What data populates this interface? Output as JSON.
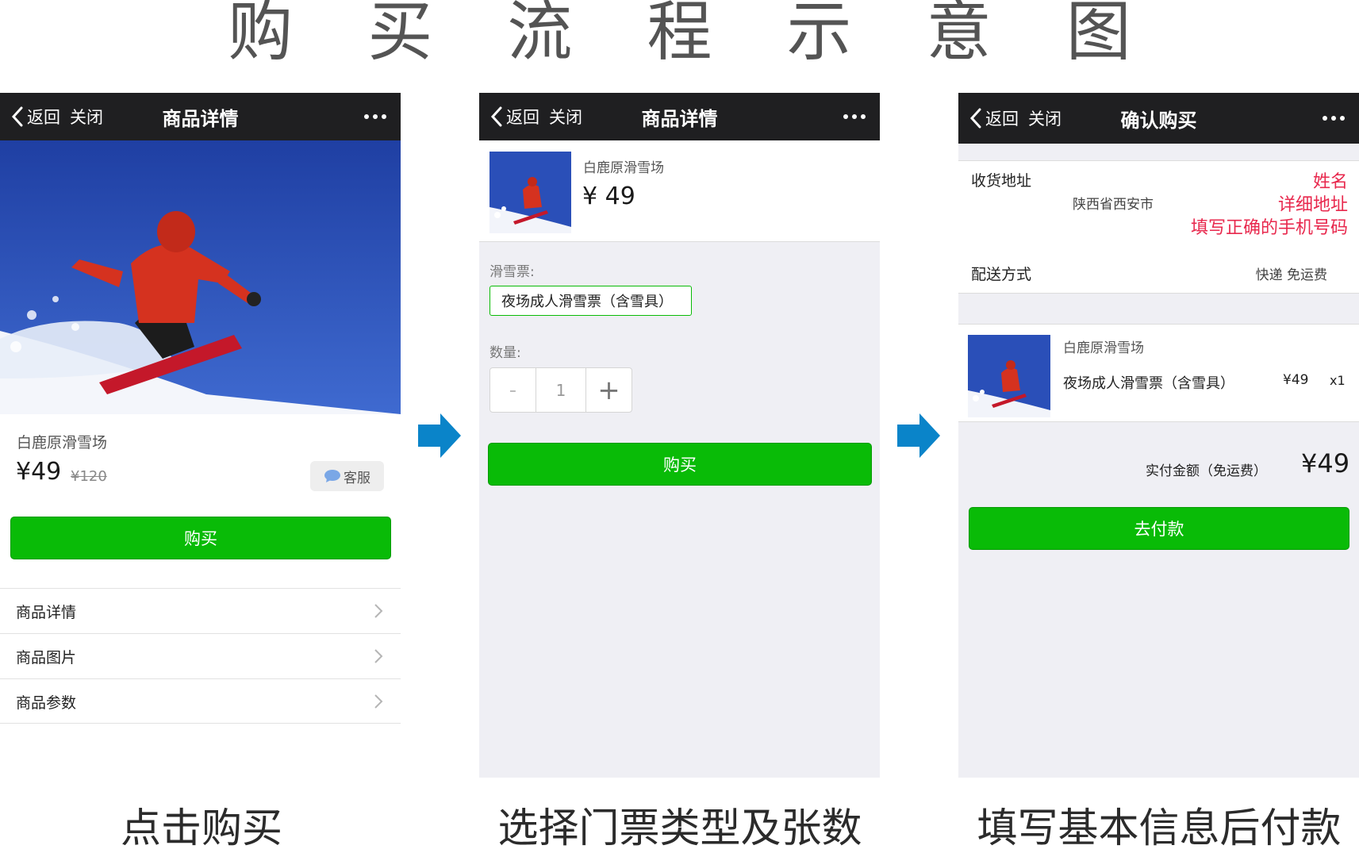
{
  "title": "购 买 流 程 示 意 图",
  "colors": {
    "accent_green": "#09bb07",
    "navbar": "#1f1f21",
    "arrow_blue": "#0a84c9",
    "highlight_red": "#e8284d"
  },
  "nav": {
    "back_icon": "chevron-left-icon",
    "back_label": "返回",
    "close_label": "关闭",
    "more_icon": "more-dots-icon"
  },
  "screen1": {
    "nav_title": "商品详情",
    "shop_name": "白鹿原滑雪场",
    "price": "¥49",
    "original_price": "¥120",
    "customer_service": "客服",
    "buy_button": "购买",
    "menu": [
      "商品详情",
      "商品图片",
      "商品参数"
    ],
    "caption": "点击购买"
  },
  "screen2": {
    "nav_title": "商品详情",
    "shop_name": "白鹿原滑雪场",
    "price": "¥ 49",
    "ticket_label": "滑雪票:",
    "ticket_option": "夜场成人滑雪票（含雪具）",
    "quantity_label": "数量:",
    "quantity_minus": "-",
    "quantity_value": "1",
    "quantity_plus": "+",
    "buy_button": "购买",
    "caption": "选择门票类型及张数"
  },
  "screen3": {
    "nav_title": "确认购买",
    "address_label": "收货地址",
    "address_region": "陕西省西安市",
    "address_name": "姓名",
    "address_detail": "详细地址",
    "address_phone": "填写正确的手机号码",
    "shipping_label": "配送方式",
    "shipping_value": "快递 免运费",
    "order_shop": "白鹿原滑雪场",
    "order_item": "夜场成人滑雪票（含雪具）",
    "order_price": "¥49",
    "order_qty": "x1",
    "paid_label": "实付金额（免运费）",
    "paid_amount": "¥49",
    "pay_button": "去付款",
    "caption": "填写基本信息后付款"
  }
}
